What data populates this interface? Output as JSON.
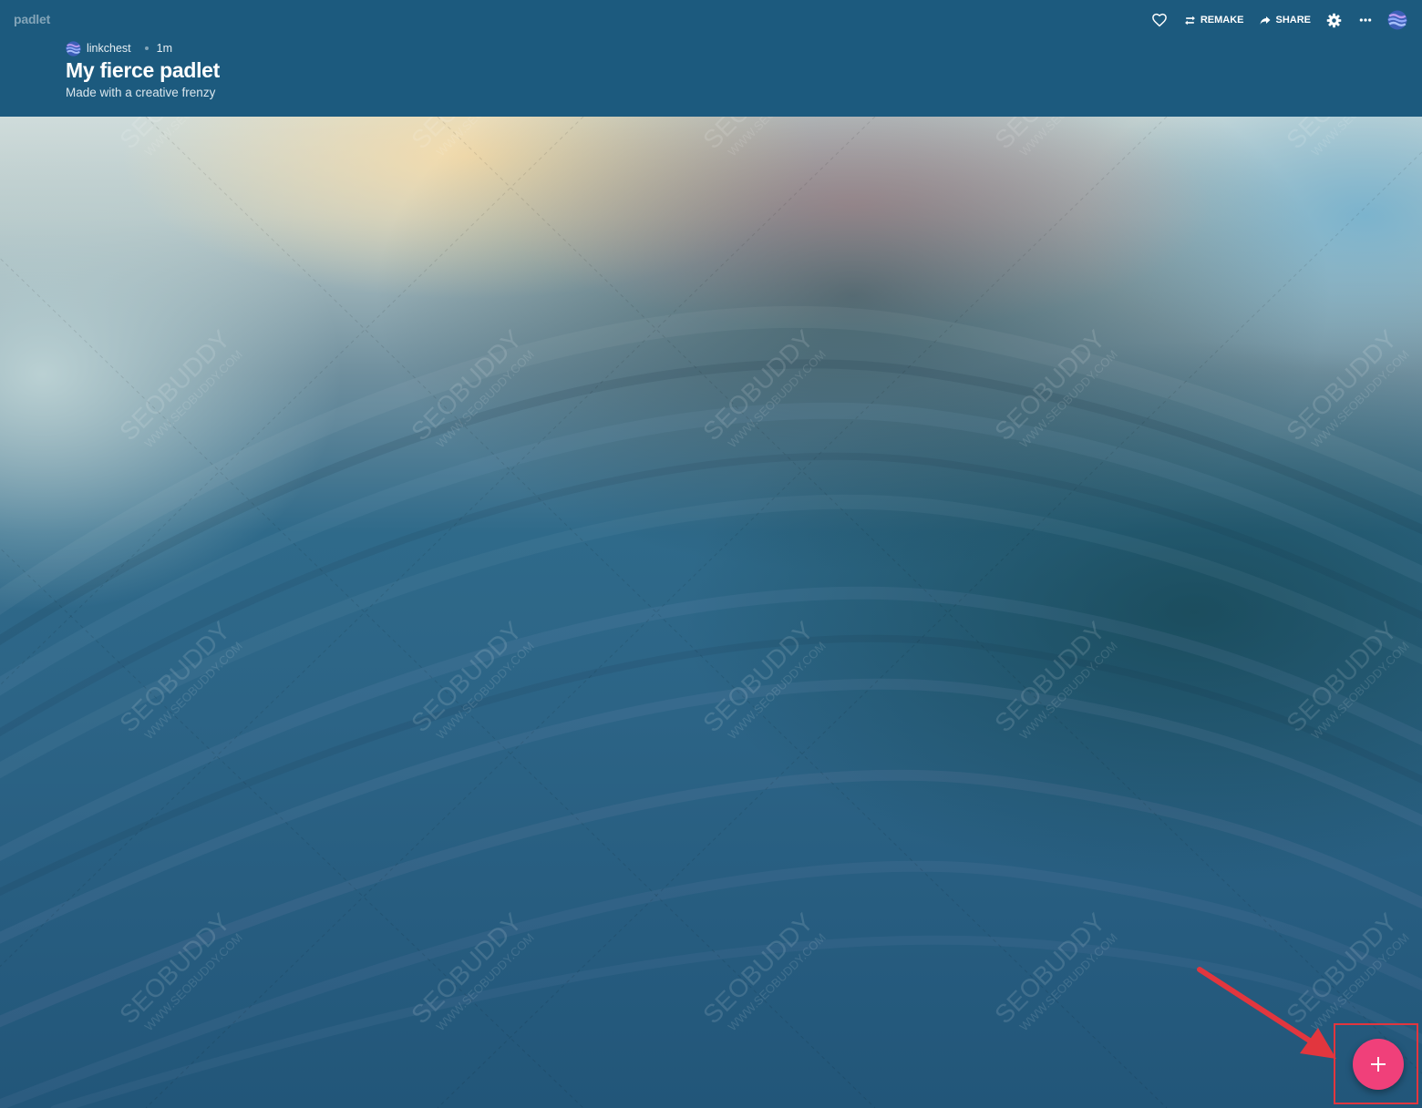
{
  "app": {
    "brand": "padlet"
  },
  "header": {
    "author": "linkchest",
    "time_ago": "1m",
    "title": "My fierce padlet",
    "subtitle": "Made with a creative frenzy"
  },
  "toolbar": {
    "remake_label": "REMAKE",
    "share_label": "SHARE",
    "icons": [
      "heart-icon",
      "remake-icon",
      "share-icon",
      "gear-icon",
      "more-icon",
      "avatar"
    ]
  },
  "fab": {
    "icon": "plus-icon",
    "color": "#f0407a"
  },
  "watermark": {
    "text": "SEOBUDDY",
    "url": "WWW.SEOBUDDY.COM"
  },
  "colors": {
    "header": "#1c5a7e",
    "annotation": "#e2363e"
  }
}
